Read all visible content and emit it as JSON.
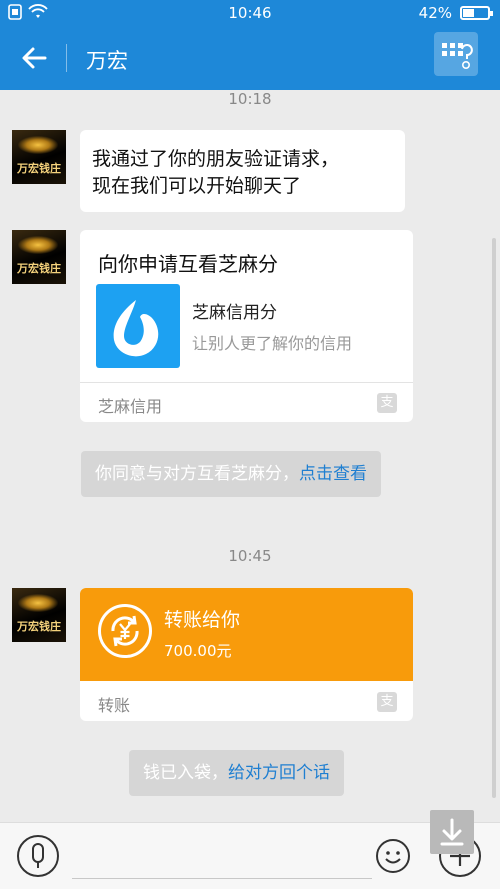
{
  "status_bar": {
    "time": "10:46",
    "battery_percent": "42%",
    "battery_level": 0.42
  },
  "header": {
    "title": "万宏"
  },
  "avatar_text": "万宏钱庄",
  "messages": {
    "timestamp_1": "10:18",
    "text_message": [
      "我通过了你的朋友验证请求，",
      "现在我们可以开始聊天了"
    ],
    "card": {
      "title": "向你申请互看芝麻分",
      "app_name": "芝麻信用分",
      "app_desc": "让别人更了解你的信用",
      "footer": "芝麻信用"
    },
    "notice_1": {
      "text": "你同意与对方互看芝麻分，",
      "link": "点击查看"
    },
    "timestamp_2": "10:45",
    "transfer": {
      "title": "转账给你",
      "amount": "700.00元",
      "footer": "转账"
    },
    "notice_2": {
      "text": "钱已入袋，",
      "link": "给对方回个话"
    }
  },
  "footer_mark_glyph": "支",
  "colors": {
    "primary": "#1e88d8",
    "transfer": "#f89b0b",
    "link": "#1f7fd1",
    "background": "#ebebeb"
  },
  "icons": [
    "wifi-icon",
    "sim-icon",
    "back-arrow-icon",
    "profile-settings-icon",
    "coin-icon",
    "voice-icon",
    "emoji-icon",
    "plus-icon",
    "scroll-down-icon"
  ]
}
